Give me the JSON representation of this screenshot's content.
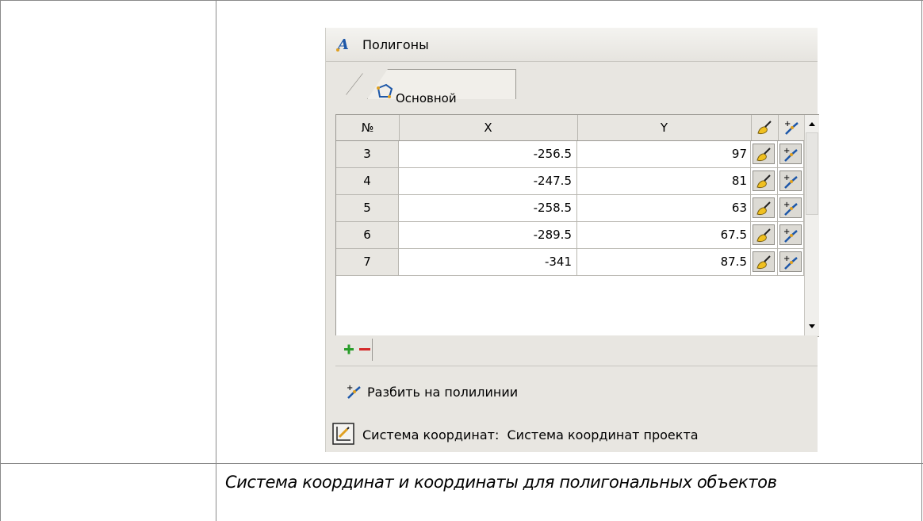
{
  "panel": {
    "title": "Полигоны",
    "tab_label": "Основной"
  },
  "grid": {
    "columns": [
      "№",
      "X",
      "Y"
    ],
    "rows": [
      {
        "n": "3",
        "x": "-256.5",
        "y": "97"
      },
      {
        "n": "4",
        "x": "-247.5",
        "y": "81"
      },
      {
        "n": "5",
        "x": "-258.5",
        "y": "63"
      },
      {
        "n": "6",
        "x": "-289.5",
        "y": "67.5"
      },
      {
        "n": "7",
        "x": "-341",
        "y": "87.5"
      }
    ]
  },
  "actions": {
    "split_label": "Разбить на полилинии",
    "coord_system_label": "Система координат:",
    "coord_system_value": "Система координат проекта"
  },
  "caption": "Система координат и координаты для полигональных объектов",
  "icons": {
    "title": "polygon-a-icon",
    "tab": "polygon-icon",
    "row_action_1": "fill-brush-icon",
    "row_action_2": "split-polyline-icon",
    "add": "plus-icon",
    "remove": "minus-icon",
    "coord": "coordinate-system-icon"
  },
  "colors": {
    "add": "#2a9d2a",
    "remove": "#d42a2a",
    "panel_bg": "#e8e6e1"
  }
}
